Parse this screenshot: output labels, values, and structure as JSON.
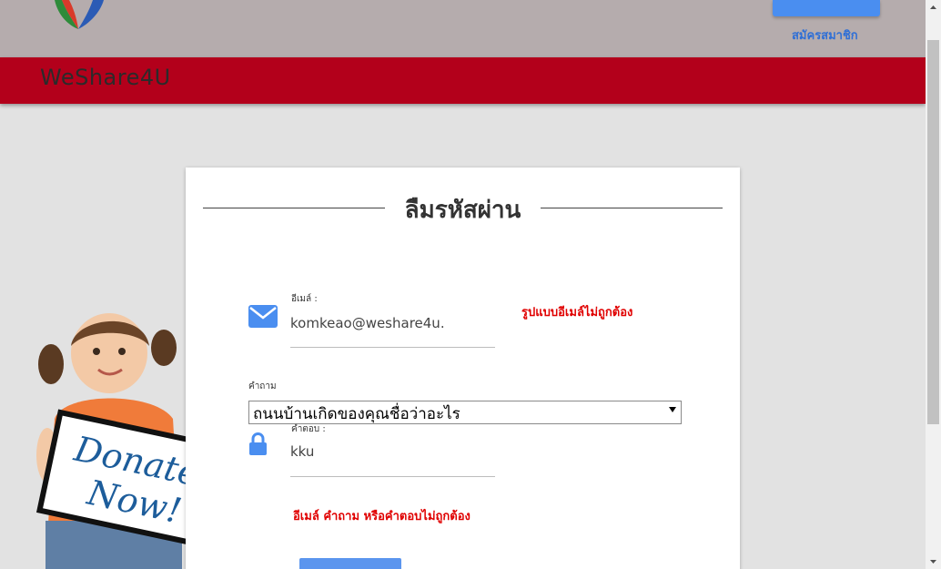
{
  "header": {
    "login_label": "",
    "register_link": "สมัครสมาชิก"
  },
  "brand": {
    "name": "WeShare4U"
  },
  "card": {
    "title": "ลืมรหัสผ่าน",
    "email": {
      "label": "อีเมล์ :",
      "value": "komkeao@weshare4u.",
      "error": "รูปแบบอีเมล์ไม่ถูกต้อง"
    },
    "question": {
      "label": "คำถาม",
      "selected": "ถนนบ้านเกิดของคุณชื่อว่าอะไร"
    },
    "answer": {
      "label": "คำตอบ :",
      "value": "kku"
    },
    "form_error": "อีเมล์ คำถาม หรือคำตอบไม่ถูกต้อง",
    "submit_label": ""
  },
  "illustration": {
    "sign_text_1": "Donate",
    "sign_text_2": "Now!"
  },
  "colors": {
    "brand_bar": "#b3001b",
    "header_bg": "#b5acad",
    "accent": "#4a8ef0",
    "error": "#e00000"
  }
}
